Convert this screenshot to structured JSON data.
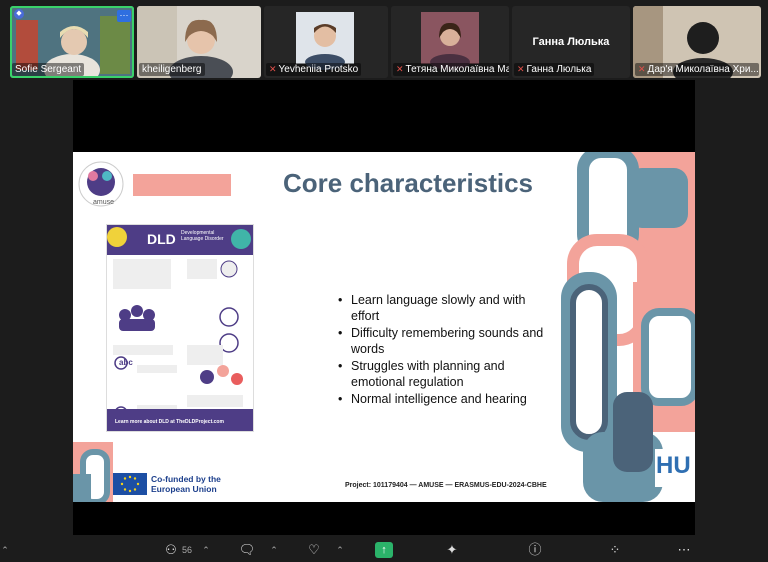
{
  "participants": [
    {
      "name": "Sofie Sergeant",
      "active": true
    },
    {
      "name": "kheiligenberg"
    },
    {
      "name": "Yevheniia Protsko",
      "muted": true
    },
    {
      "name": "Тетяна Миколаївна Ма...",
      "muted": true
    },
    {
      "name": "Ганна Люлька",
      "muted": true,
      "display_name": "Ганна Люлька"
    },
    {
      "name": "Дар'я Миколаївна Хри...",
      "muted": true
    }
  ],
  "tile_more_label": "···",
  "slide": {
    "title": "Core characteristics",
    "bullets": [
      "Learn language slowly and with effort",
      "Difficulty remembering sounds and words",
      "Struggles with planning and emotional regulation",
      "Normal intelligence and hearing"
    ],
    "logo_text": "amuse",
    "poster_title": "DLD",
    "poster_subtitle": "Developmental Language Disorder",
    "poster_abc": "abc",
    "poster_footer": "Learn more about DLD at TheDLDProject.com",
    "cofunded": "Co-funded by the European Union",
    "project": "Project: 101179404 — AMUSE — ERASMUS-EDU-2024-CBHE",
    "university_mark": "HU",
    "colors": {
      "title": "#4b6379",
      "salmon": "#f3a39a",
      "slate": "#6a95a8",
      "purple": "#4e3d86"
    }
  },
  "toolbar": {
    "participants_count": "56",
    "icons": [
      "participants-icon",
      "chat-icon",
      "reactions-icon",
      "share-screen-icon",
      "ai-companion-icon",
      "info-icon",
      "apps-icon",
      "more-icon"
    ]
  }
}
